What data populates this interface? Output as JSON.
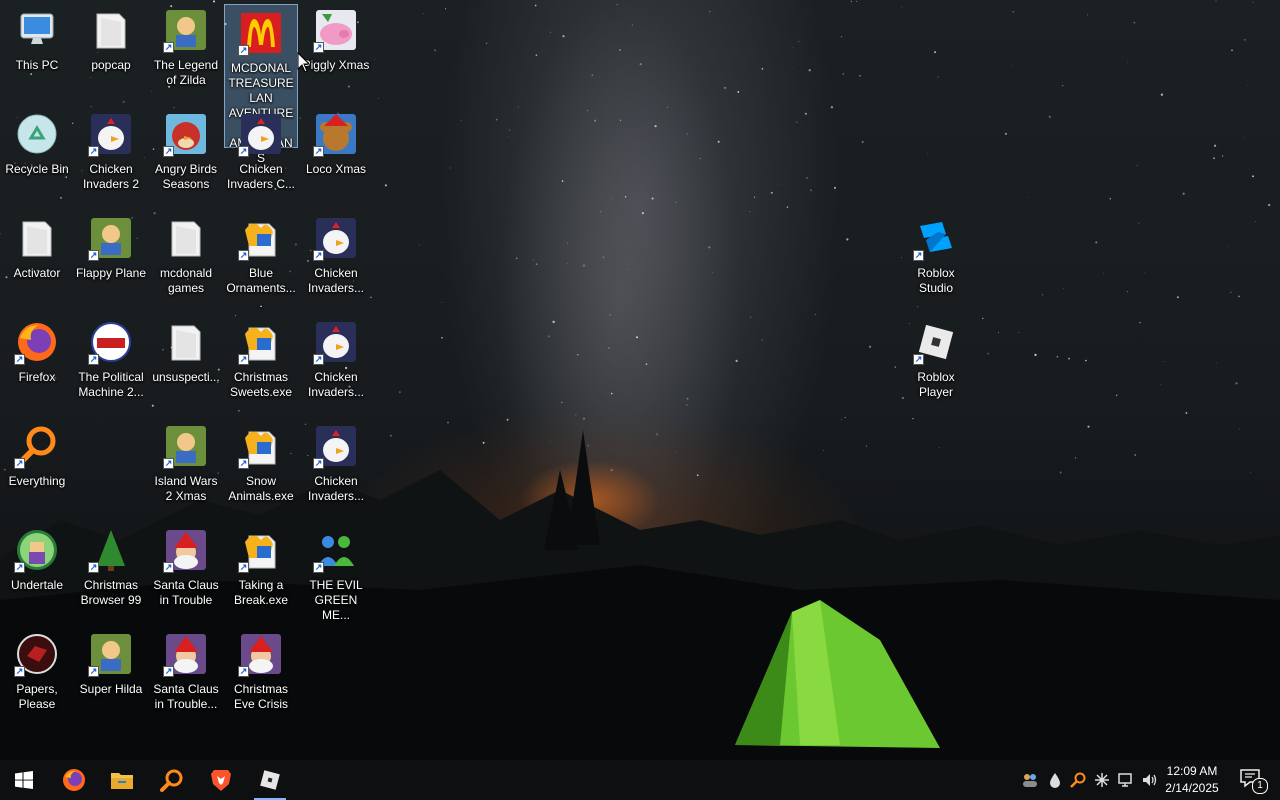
{
  "desktop": {
    "icons": [
      {
        "label": "This PC",
        "icon": "monitor-icon"
      },
      {
        "label": "popcap",
        "icon": "folder-icon"
      },
      {
        "label": "The Legend of Zilda",
        "icon": "game-icon"
      },
      {
        "label": "MCDONAL TREASURE LAN AVENTURE FOR AMERICANS",
        "icon": "mcdonalds-icon"
      },
      {
        "label": "Piggly Xmas",
        "icon": "pig-icon"
      },
      {
        "label": "Recycle Bin",
        "icon": "recycle-bin-icon"
      },
      {
        "label": "Chicken Invaders 2",
        "icon": "chicken-icon"
      },
      {
        "label": "Angry Birds Seasons",
        "icon": "angry-bird-icon"
      },
      {
        "label": "Chicken Invaders C...",
        "icon": "chicken-icon"
      },
      {
        "label": "Loco Xmas",
        "icon": "bear-icon"
      },
      {
        "label": "Activator",
        "icon": "folder-icon"
      },
      {
        "label": "Flappy Plane",
        "icon": "game-icon"
      },
      {
        "label": "mcdonald games",
        "icon": "folder-icon"
      },
      {
        "label": "Blue Ornaments....",
        "icon": "exe-icon"
      },
      {
        "label": "Chicken Invaders...",
        "icon": "chicken-icon"
      },
      {
        "label": "Firefox",
        "icon": "firefox-icon"
      },
      {
        "label": "The Political Machine 2...",
        "icon": "political-machine-icon"
      },
      {
        "label": "unsuspecti...",
        "icon": "folder-icon"
      },
      {
        "label": "Christmas Sweets.exe",
        "icon": "exe-icon"
      },
      {
        "label": "Chicken Invaders...",
        "icon": "chicken-icon"
      },
      {
        "label": "Everything",
        "icon": "magnifier-icon"
      },
      {
        "label": "Island Wars 2 Xmas",
        "icon": "game-icon"
      },
      {
        "label": "Snow Animals.exe",
        "icon": "exe-icon"
      },
      {
        "label": "Chicken Invaders...",
        "icon": "chicken-icon"
      },
      {
        "label": "Undertale",
        "icon": "undertale-icon"
      },
      {
        "label": "Christmas Browser 99",
        "icon": "christmas-tree-icon"
      },
      {
        "label": "Santa Claus in Trouble",
        "icon": "santa-icon"
      },
      {
        "label": "Taking a Break.exe",
        "icon": "exe-icon"
      },
      {
        "label": "THE EVIL GREEN ME...",
        "icon": "messenger-icon"
      },
      {
        "label": "Papers, Please",
        "icon": "papers-please-icon"
      },
      {
        "label": "Super Hilda",
        "icon": "game-icon"
      },
      {
        "label": "Santa Claus in Trouble...",
        "icon": "santa-icon"
      },
      {
        "label": "Christmas Eve Crisis",
        "icon": "santa-icon"
      },
      {
        "label": "Roblox Studio",
        "icon": "roblox-studio-icon"
      },
      {
        "label": "Roblox Player",
        "icon": "roblox-icon"
      }
    ]
  },
  "taskbar": {
    "start": "windows-start-icon",
    "pinned": [
      "firefox-icon",
      "file-explorer-icon",
      "everything-search-icon",
      "brave-icon",
      "roblox-icon"
    ],
    "tray": [
      "people-icon",
      "droplet-icon",
      "search-icon",
      "snowflake-icon",
      "network-icon",
      "volume-icon"
    ],
    "clock": {
      "time": "12:09 AM",
      "date": "2/14/2025"
    },
    "notification_count": "1"
  }
}
